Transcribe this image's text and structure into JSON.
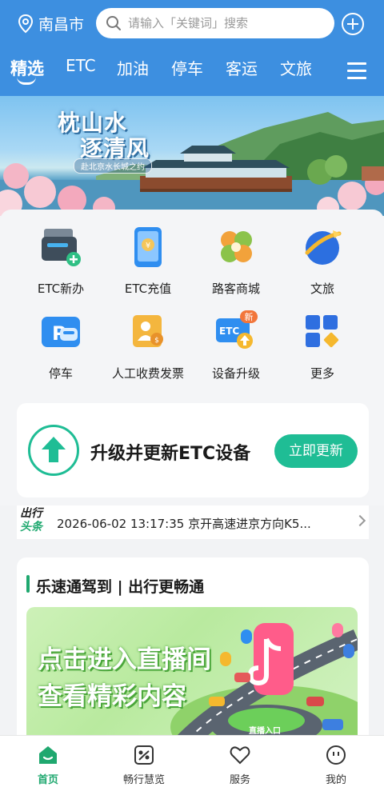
{
  "header": {
    "city": "南昌市",
    "search_placeholder": "请输入「关键词」搜索",
    "tabs": [
      "精选",
      "ETC",
      "加油",
      "停车",
      "客运",
      "文旅"
    ]
  },
  "banner": {
    "title_line1": "枕山水",
    "title_line2": "逐清风",
    "subtitle": "赴北京水长城之约"
  },
  "services": [
    {
      "label": "ETC新办",
      "icon": "etc-card-add-icon"
    },
    {
      "label": "ETC充值",
      "icon": "etc-recharge-icon"
    },
    {
      "label": "路客商城",
      "icon": "mall-clover-icon"
    },
    {
      "label": "文旅",
      "icon": "travel-plane-icon"
    },
    {
      "label": "停车",
      "icon": "parking-icon"
    },
    {
      "label": "人工收费发票",
      "icon": "invoice-person-icon"
    },
    {
      "label": "设备升级",
      "icon": "etc-upgrade-icon"
    },
    {
      "label": "更多",
      "icon": "more-grid-icon"
    }
  ],
  "upgrade": {
    "text": "升级并更新ETC设备",
    "button": "立即更新"
  },
  "news": {
    "logo_line1": "出行",
    "logo_line2": "头条",
    "text": "2026-06-02 13:17:35 京开高速进京方向K5..."
  },
  "live": {
    "title": "乐速通驾到 | 出行更畅通",
    "image_line1": "点击进入直播间",
    "image_line2": "查看精彩内容",
    "entrance_label": "直播入口"
  },
  "bottom_nav": [
    {
      "label": "首页",
      "icon": "home-icon",
      "active": true
    },
    {
      "label": "畅行慧览",
      "icon": "map-icon",
      "active": false
    },
    {
      "label": "服务",
      "icon": "heart-icon",
      "active": false
    },
    {
      "label": "我的",
      "icon": "profile-icon",
      "active": false
    }
  ],
  "colors": {
    "header_blue": "#3d8fe0",
    "accent_green": "#1fbd95",
    "nav_green": "#1fa86f"
  }
}
